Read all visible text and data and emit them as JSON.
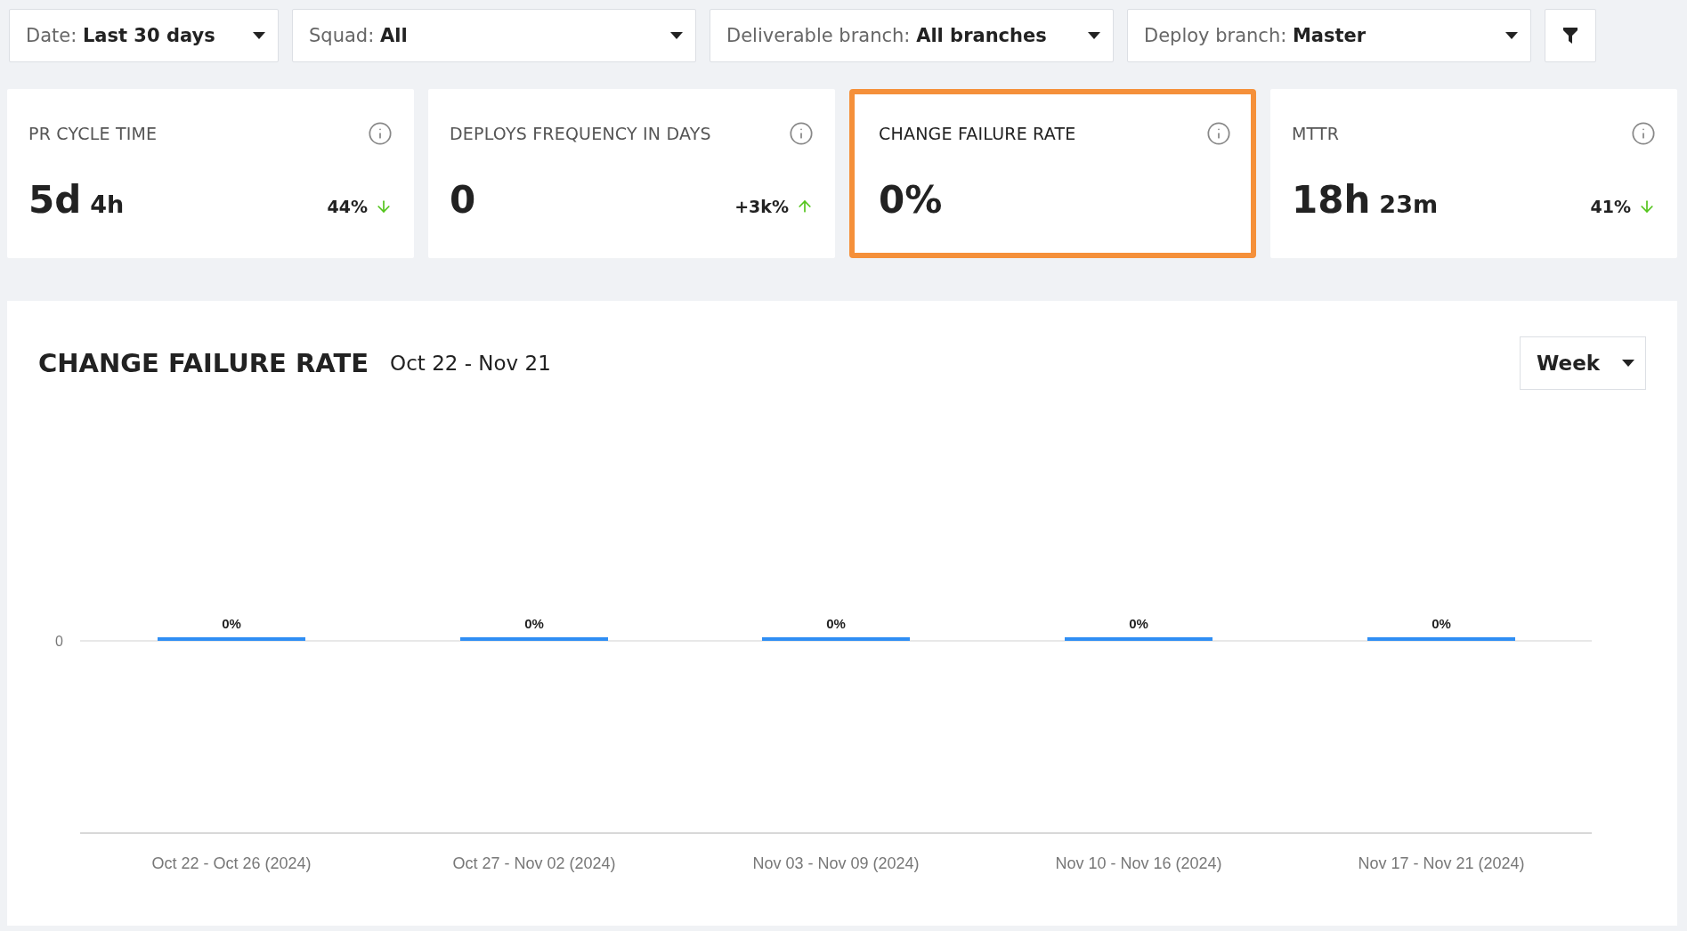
{
  "filters": [
    {
      "label": "Date:",
      "value": "Last 30 days"
    },
    {
      "label": "Squad:",
      "value": "All"
    },
    {
      "label": "Deliverable branch:",
      "value": "All branches"
    },
    {
      "label": "Deploy branch:",
      "value": "Master"
    }
  ],
  "metrics": [
    {
      "title": "PR CYCLE TIME",
      "selected": false,
      "value": [
        {
          "text": "5d",
          "kind": "major"
        },
        {
          "text": "4h",
          "kind": "minor"
        }
      ],
      "change": "44%",
      "rising": false
    },
    {
      "title": "DEPLOYS FREQUENCY IN DAYS",
      "selected": false,
      "value": [
        {
          "text": "0",
          "kind": "major"
        }
      ],
      "change": "+3k%",
      "rising": true
    },
    {
      "title": "CHANGE FAILURE RATE",
      "selected": true,
      "value": [
        {
          "text": "0%",
          "kind": "major"
        }
      ]
    },
    {
      "title": "MTTR",
      "selected": false,
      "value": [
        {
          "text": "18h",
          "kind": "major"
        },
        {
          "text": "23m",
          "kind": "minor"
        }
      ],
      "change": "41%",
      "rising": false
    }
  ],
  "chart_panel": {
    "title": "CHANGE FAILURE RATE",
    "range": "Oct 22 - Nov 21",
    "period": "Week",
    "y_axis_label": "0",
    "bars": [
      {
        "period": "Oct 22 - Oct 26 (2024)",
        "label": "0%"
      },
      {
        "period": "Oct 27 - Nov 02 (2024)",
        "label": "0%"
      },
      {
        "period": "Nov 03 - Nov 09 (2024)",
        "label": "0%"
      },
      {
        "period": "Nov 10 - Nov 16 (2024)",
        "label": "0%"
      },
      {
        "period": "Nov 17 - Nov 21 (2024)",
        "label": "0%"
      }
    ]
  }
}
